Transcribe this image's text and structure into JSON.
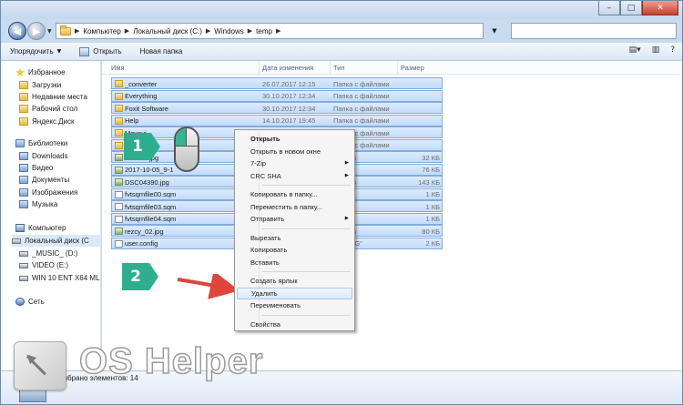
{
  "window": {
    "buttons": {
      "minimize": "–",
      "maximize": "□",
      "close": "✕"
    }
  },
  "address": {
    "crumbs": [
      "Компьютер",
      "Локальный диск (C:)",
      "Windows",
      "temp"
    ],
    "search_placeholder": ""
  },
  "toolbar": {
    "organize_label": "Упорядочить",
    "open_label": "Открыть",
    "new_folder_label": "Новая папка"
  },
  "nav": {
    "items": [
      {
        "label": "Избранное",
        "icon": "star-icon"
      },
      {
        "label": "Загрузки",
        "icon": "folder-icon"
      },
      {
        "label": "Недавние места",
        "icon": "folder-icon"
      },
      {
        "label": "Рабочий стол",
        "icon": "folder-icon"
      },
      {
        "label": "Яндекс.Диск",
        "icon": "folder-icon"
      },
      {
        "label": "Библиотеки",
        "icon": "library-icon"
      },
      {
        "label": "Downloads",
        "icon": "library-icon"
      },
      {
        "label": "Видео",
        "icon": "library-icon"
      },
      {
        "label": "Документы",
        "icon": "library-icon"
      },
      {
        "label": "Изображения",
        "icon": "library-icon"
      },
      {
        "label": "Музыка",
        "icon": "library-icon"
      },
      {
        "label": "Компьютер",
        "icon": "computer-icon"
      },
      {
        "label": "Локальный диск (C",
        "icon": "drive-icon"
      },
      {
        "label": "_MUSIC_ (D:)",
        "icon": "drive-icon"
      },
      {
        "label": "VIDEO (E:)",
        "icon": "drive-icon"
      },
      {
        "label": "WIN 10 ENT X64 ML",
        "icon": "drive-icon"
      },
      {
        "label": "Сеть",
        "icon": "network-icon"
      }
    ]
  },
  "columns": {
    "name": "Имя",
    "date": "Дата изменения",
    "type": "Тип",
    "size": "Размер"
  },
  "files": [
    {
      "name": "_converter",
      "date": "26.07.2017 12:15",
      "type": "Папка с файлами",
      "size": ""
    },
    {
      "name": "Everything",
      "date": "30.10.2017 12:34",
      "type": "Папка с файлами",
      "size": ""
    },
    {
      "name": "Foxit Software",
      "date": "30.10.2017 12:34",
      "type": "Папка с файлами",
      "size": ""
    },
    {
      "name": "Help",
      "date": "14.10.2017 19:45",
      "type": "Папка с файлами",
      "size": ""
    },
    {
      "name": "Movavi",
      "date": "",
      "type": "Папка с файлами",
      "size": ""
    },
    {
      "name": "",
      "date": "",
      "type": "Папка с файлами",
      "size": ""
    },
    {
      "name": "2475ea.jpg",
      "date": "",
      "type": "k JPEG",
      "size": "32 КБ"
    },
    {
      "name": "2017-10-05_9-1",
      "date": "",
      "type": "k PNG",
      "size": "76 КБ"
    },
    {
      "name": "DSC04390.jpg",
      "date": "",
      "type": "k JPEG",
      "size": "143 КБ"
    },
    {
      "name": "fvtsqmfile00.sqm",
      "date": "",
      "type": "SQM\"",
      "size": "1 КБ"
    },
    {
      "name": "fvtsqmfile03.sqm",
      "date": "",
      "type": "SQM\"",
      "size": "1 КБ"
    },
    {
      "name": "fvtsqmfile04.sqm",
      "date": "",
      "type": "SQM\"",
      "size": "1 КБ"
    },
    {
      "name": "rezcy_02.jpg",
      "date": "",
      "type": "k JPEG",
      "size": "80 КБ"
    },
    {
      "name": "user.config",
      "date": "",
      "type": "CONFIG\"",
      "size": "2 КБ"
    }
  ],
  "context_menu": {
    "items": [
      {
        "label": "Открыть",
        "bold": true
      },
      {
        "label": "Открыть в новом окне"
      },
      {
        "label": "7-Zip",
        "submenu": true
      },
      {
        "label": "CRC SHA",
        "submenu": true
      },
      {
        "separator": true
      },
      {
        "label": "Копировать в папку..."
      },
      {
        "label": "Переместить в папку..."
      },
      {
        "label": "Отправить",
        "submenu": true
      },
      {
        "separator": true
      },
      {
        "label": "Вырезать"
      },
      {
        "label": "Копировать"
      },
      {
        "label": "Вставить"
      },
      {
        "separator": true
      },
      {
        "label": "Создать ярлык"
      },
      {
        "label": "Удалить",
        "highlighted": true
      },
      {
        "label": "Переименовать"
      },
      {
        "separator": true
      },
      {
        "label": "Свойства"
      }
    ]
  },
  "annotations": {
    "step1": "1",
    "step2": "2"
  },
  "status": {
    "text": "Выбрано элементов: 14"
  },
  "watermark": {
    "text": "OS Helper"
  },
  "colors": {
    "accent": "#2eae8f",
    "arrow": "#e0453a",
    "selection": "#c1dcfc"
  }
}
